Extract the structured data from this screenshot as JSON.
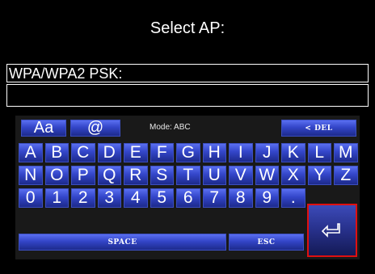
{
  "header": {
    "title": "Select AP:"
  },
  "field": {
    "label": "WPA/WPA2 PSK:",
    "value": ""
  },
  "keyboard": {
    "mode_label": "Mode: ABC",
    "toggle_case_label": "Aa",
    "at_label": "@",
    "delete_label": "< DEL",
    "row1": [
      "A",
      "B",
      "C",
      "D",
      "E",
      "F",
      "G",
      "H",
      "I",
      "J",
      "K",
      "L",
      "M"
    ],
    "row2": [
      "N",
      "O",
      "P",
      "Q",
      "R",
      "S",
      "T",
      "U",
      "V",
      "W",
      "X",
      "Y",
      "Z"
    ],
    "row3": [
      "0",
      "1",
      "2",
      "3",
      "4",
      "5",
      "6",
      "7",
      "8",
      "9",
      "."
    ],
    "space_label": "SPACE",
    "esc_label": "ESC",
    "enter_icon": "enter-return-icon"
  },
  "colors": {
    "background": "#000000",
    "key_blue": "#3345c8",
    "enter_border": "#e01010",
    "text": "#ffffff"
  }
}
